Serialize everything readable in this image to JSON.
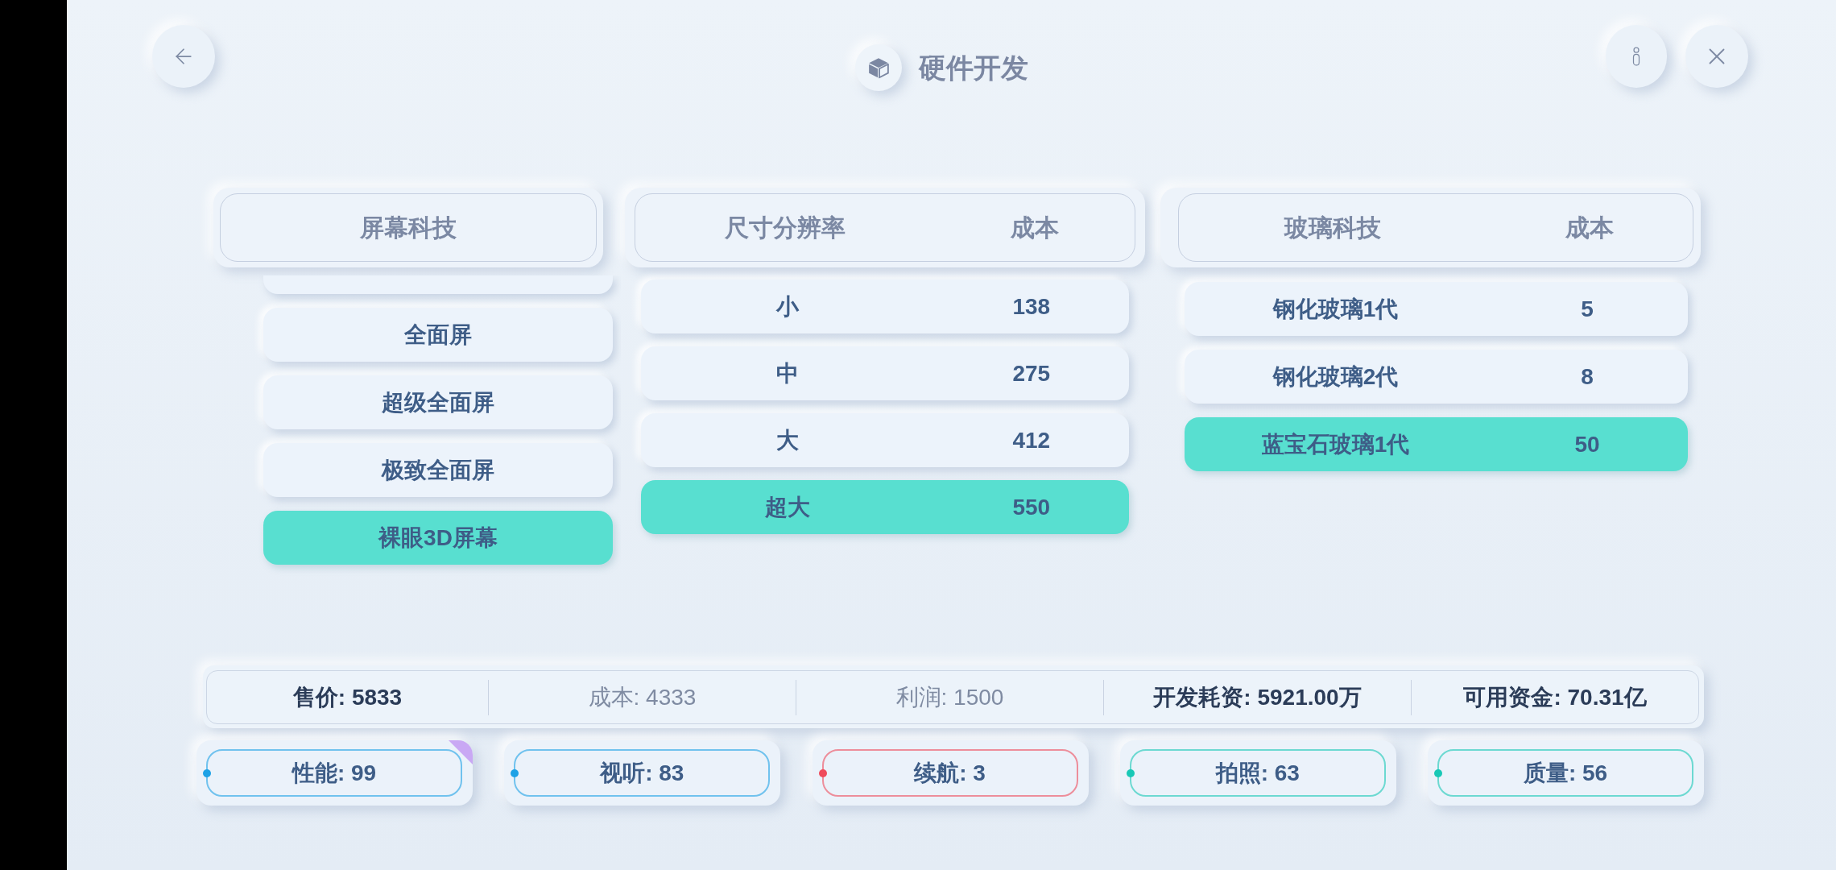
{
  "header": {
    "title": "硬件开发"
  },
  "panels": [
    {
      "columns": [
        "屏幕科技"
      ],
      "clipped_item": {
        "selected": false
      },
      "rows": [
        {
          "cells": [
            "全面屏"
          ],
          "selected": false
        },
        {
          "cells": [
            "超级全面屏"
          ],
          "selected": false
        },
        {
          "cells": [
            "极致全面屏"
          ],
          "selected": false
        },
        {
          "cells": [
            "裸眼3D屏幕"
          ],
          "selected": true
        }
      ]
    },
    {
      "columns": [
        "尺寸分辨率",
        "成本"
      ],
      "rows": [
        {
          "cells": [
            "小",
            "138"
          ],
          "selected": false
        },
        {
          "cells": [
            "中",
            "275"
          ],
          "selected": false
        },
        {
          "cells": [
            "大",
            "412"
          ],
          "selected": false
        },
        {
          "cells": [
            "超大",
            "550"
          ],
          "selected": true
        }
      ]
    },
    {
      "columns": [
        "玻璃科技",
        "成本"
      ],
      "rows": [
        {
          "cells": [
            "钢化玻璃1代",
            "5"
          ],
          "selected": false
        },
        {
          "cells": [
            "钢化玻璃2代",
            "8"
          ],
          "selected": false
        },
        {
          "cells": [
            "蓝宝石玻璃1代",
            "50"
          ],
          "selected": true
        }
      ]
    }
  ],
  "stats": [
    {
      "text": "售价: 5833",
      "muted": false
    },
    {
      "text": "成本: 4333",
      "muted": true
    },
    {
      "text": "利润: 1500",
      "muted": true
    },
    {
      "text": "开发耗资: 5921.00万",
      "muted": false
    },
    {
      "text": "可用资金: 70.31亿",
      "muted": false
    }
  ],
  "attributes": [
    {
      "text": "性能: 99",
      "color": "#1ea2e6",
      "flagged": true
    },
    {
      "text": "视听: 83",
      "color": "#1ea2e6",
      "flagged": false
    },
    {
      "text": "续航: 3",
      "color": "#ef4b5b",
      "flagged": false
    },
    {
      "text": "拍照: 63",
      "color": "#18c8b6",
      "flagged": false
    },
    {
      "text": "质量: 56",
      "color": "#18c8b6",
      "flagged": false
    }
  ]
}
